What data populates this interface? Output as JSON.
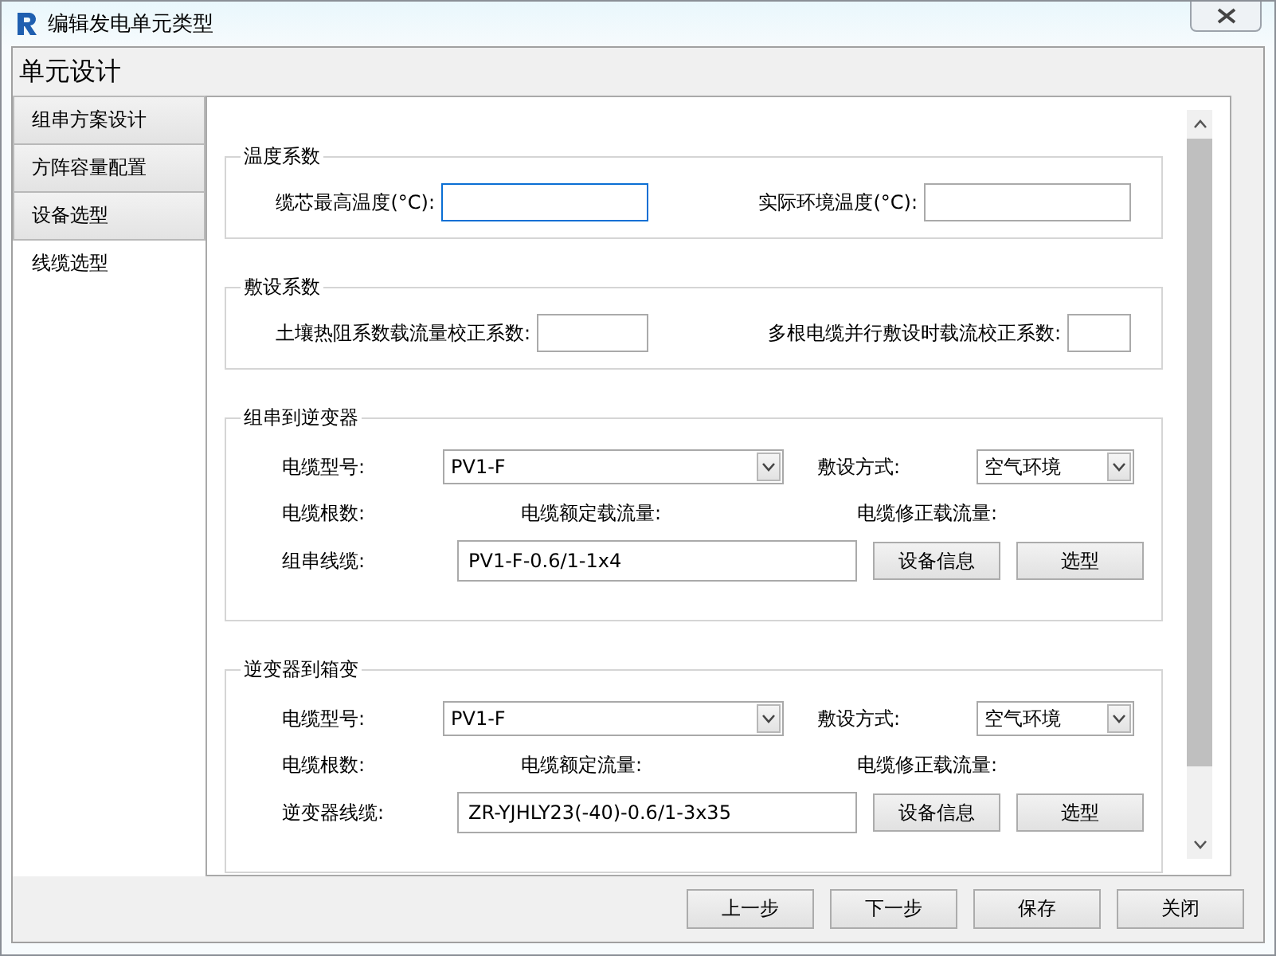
{
  "window": {
    "title": "编辑发电单元类型"
  },
  "header": "单元设计",
  "sidebar": {
    "items": [
      {
        "label": "组串方案设计",
        "selected": false
      },
      {
        "label": "方阵容量配置",
        "selected": false
      },
      {
        "label": "设备选型",
        "selected": false
      },
      {
        "label": "线缆选型",
        "selected": true
      }
    ]
  },
  "groups": [
    {
      "kind": "fields",
      "title": "温度系数",
      "fields": [
        {
          "label": "缆芯最高温度(°C):",
          "focused": true
        },
        {
          "label": "实际环境温度(°C):",
          "focused": false
        }
      ]
    },
    {
      "kind": "fields",
      "title": "敷设系数",
      "fields": [
        {
          "label": "土壤热阻系数载流量校正系数:",
          "focused": false
        },
        {
          "label": "多根电缆并行敷设时载流校正系数:",
          "focused": false
        }
      ]
    },
    {
      "kind": "cable",
      "title": "组串到逆变器",
      "cable_type_label": "电缆型号:",
      "cable_type": "PV1-F",
      "laying_label": "敷设方式:",
      "laying": "空气环境",
      "count_label": "电缆根数:",
      "rated_label": "电缆额定载流量:",
      "corrected_label": "电缆修正载流量:",
      "line_label": "组串线缆:",
      "line_value": "PV1-F-0.6/1-1x4",
      "buttons": [
        "设备信息",
        "选型"
      ]
    },
    {
      "kind": "cable",
      "title": "逆变器到箱变",
      "cable_type_label": "电缆型号:",
      "cable_type": "PV1-F",
      "laying_label": "敷设方式:",
      "laying": "空气环境",
      "count_label": "电缆根数:",
      "rated_label": "电缆额定流量:",
      "corrected_label": "电缆修正载流量:",
      "line_label": "逆变器线缆:",
      "line_value": "ZR-YJHLY23(-40)-0.6/1-3x35",
      "buttons": [
        "设备信息",
        "选型"
      ]
    }
  ],
  "footer_buttons": [
    "上一步",
    "下一步",
    "保存",
    "关闭"
  ]
}
